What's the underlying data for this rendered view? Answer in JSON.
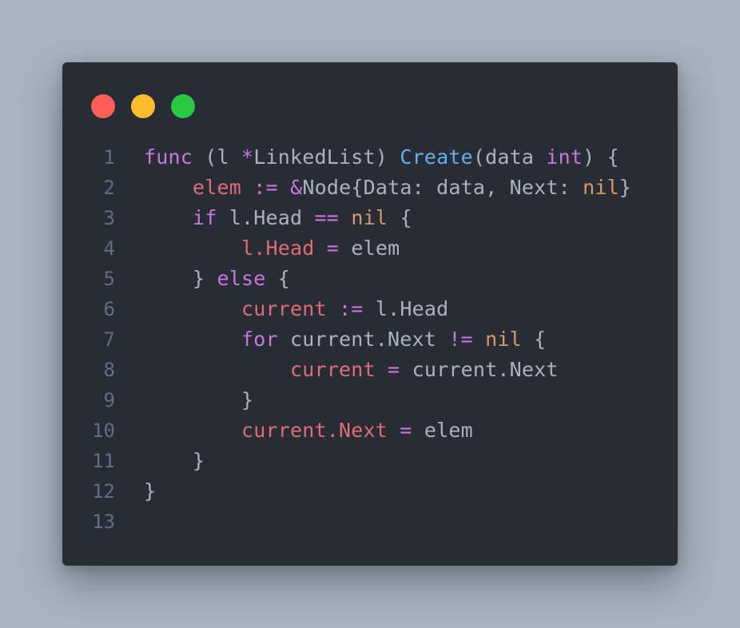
{
  "window": {
    "colors": {
      "background": "#282c34",
      "page_background": "#a9b4bf",
      "close": "#ff5f57",
      "minimize": "#febc2e",
      "maximize": "#28c840",
      "keyword": "#c678dd",
      "function": "#61afef",
      "variable": "#e06c75",
      "literal": "#d19a66",
      "plain": "#abb2bf",
      "line_number": "#636d83"
    }
  },
  "code": {
    "language": "go",
    "lines": [
      {
        "number": "1",
        "tokens": [
          {
            "t": "func",
            "c": "kw"
          },
          {
            "t": " (l ",
            "c": "plain"
          },
          {
            "t": "*",
            "c": "op"
          },
          {
            "t": "LinkedList) ",
            "c": "plain"
          },
          {
            "t": "Create",
            "c": "fn"
          },
          {
            "t": "(data ",
            "c": "plain"
          },
          {
            "t": "int",
            "c": "ty"
          },
          {
            "t": ") {",
            "c": "plain"
          }
        ]
      },
      {
        "number": "2",
        "tokens": [
          {
            "t": "    ",
            "c": "plain"
          },
          {
            "t": "elem",
            "c": "var"
          },
          {
            "t": " ",
            "c": "plain"
          },
          {
            "t": ":=",
            "c": "op"
          },
          {
            "t": " ",
            "c": "plain"
          },
          {
            "t": "&",
            "c": "op"
          },
          {
            "t": "Node{Data: data, Next: ",
            "c": "plain"
          },
          {
            "t": "nil",
            "c": "lit"
          },
          {
            "t": "}",
            "c": "plain"
          }
        ]
      },
      {
        "number": "3",
        "tokens": [
          {
            "t": "    ",
            "c": "plain"
          },
          {
            "t": "if",
            "c": "kw"
          },
          {
            "t": " l.Head ",
            "c": "plain"
          },
          {
            "t": "==",
            "c": "op"
          },
          {
            "t": " ",
            "c": "plain"
          },
          {
            "t": "nil",
            "c": "lit"
          },
          {
            "t": " {",
            "c": "plain"
          }
        ]
      },
      {
        "number": "4",
        "tokens": [
          {
            "t": "        ",
            "c": "plain"
          },
          {
            "t": "l.Head",
            "c": "var"
          },
          {
            "t": " ",
            "c": "plain"
          },
          {
            "t": "=",
            "c": "op"
          },
          {
            "t": " elem",
            "c": "plain"
          }
        ]
      },
      {
        "number": "5",
        "tokens": [
          {
            "t": "    } ",
            "c": "plain"
          },
          {
            "t": "else",
            "c": "kw"
          },
          {
            "t": " {",
            "c": "plain"
          }
        ]
      },
      {
        "number": "6",
        "tokens": [
          {
            "t": "        ",
            "c": "plain"
          },
          {
            "t": "current",
            "c": "var"
          },
          {
            "t": " ",
            "c": "plain"
          },
          {
            "t": ":=",
            "c": "op"
          },
          {
            "t": " l.Head",
            "c": "plain"
          }
        ]
      },
      {
        "number": "7",
        "tokens": [
          {
            "t": "        ",
            "c": "plain"
          },
          {
            "t": "for",
            "c": "kw"
          },
          {
            "t": " current.Next ",
            "c": "plain"
          },
          {
            "t": "!=",
            "c": "op"
          },
          {
            "t": " ",
            "c": "plain"
          },
          {
            "t": "nil",
            "c": "lit"
          },
          {
            "t": " {",
            "c": "plain"
          }
        ]
      },
      {
        "number": "8",
        "tokens": [
          {
            "t": "            ",
            "c": "plain"
          },
          {
            "t": "current",
            "c": "var"
          },
          {
            "t": " ",
            "c": "plain"
          },
          {
            "t": "=",
            "c": "op"
          },
          {
            "t": " current.Next",
            "c": "plain"
          }
        ]
      },
      {
        "number": "9",
        "tokens": [
          {
            "t": "        }",
            "c": "plain"
          }
        ]
      },
      {
        "number": "10",
        "tokens": [
          {
            "t": "        ",
            "c": "plain"
          },
          {
            "t": "current.Next",
            "c": "var"
          },
          {
            "t": " ",
            "c": "plain"
          },
          {
            "t": "=",
            "c": "op"
          },
          {
            "t": " elem",
            "c": "plain"
          }
        ]
      },
      {
        "number": "11",
        "tokens": [
          {
            "t": "    }",
            "c": "plain"
          }
        ]
      },
      {
        "number": "12",
        "tokens": [
          {
            "t": "}",
            "c": "plain"
          }
        ]
      },
      {
        "number": "13",
        "tokens": []
      }
    ]
  }
}
